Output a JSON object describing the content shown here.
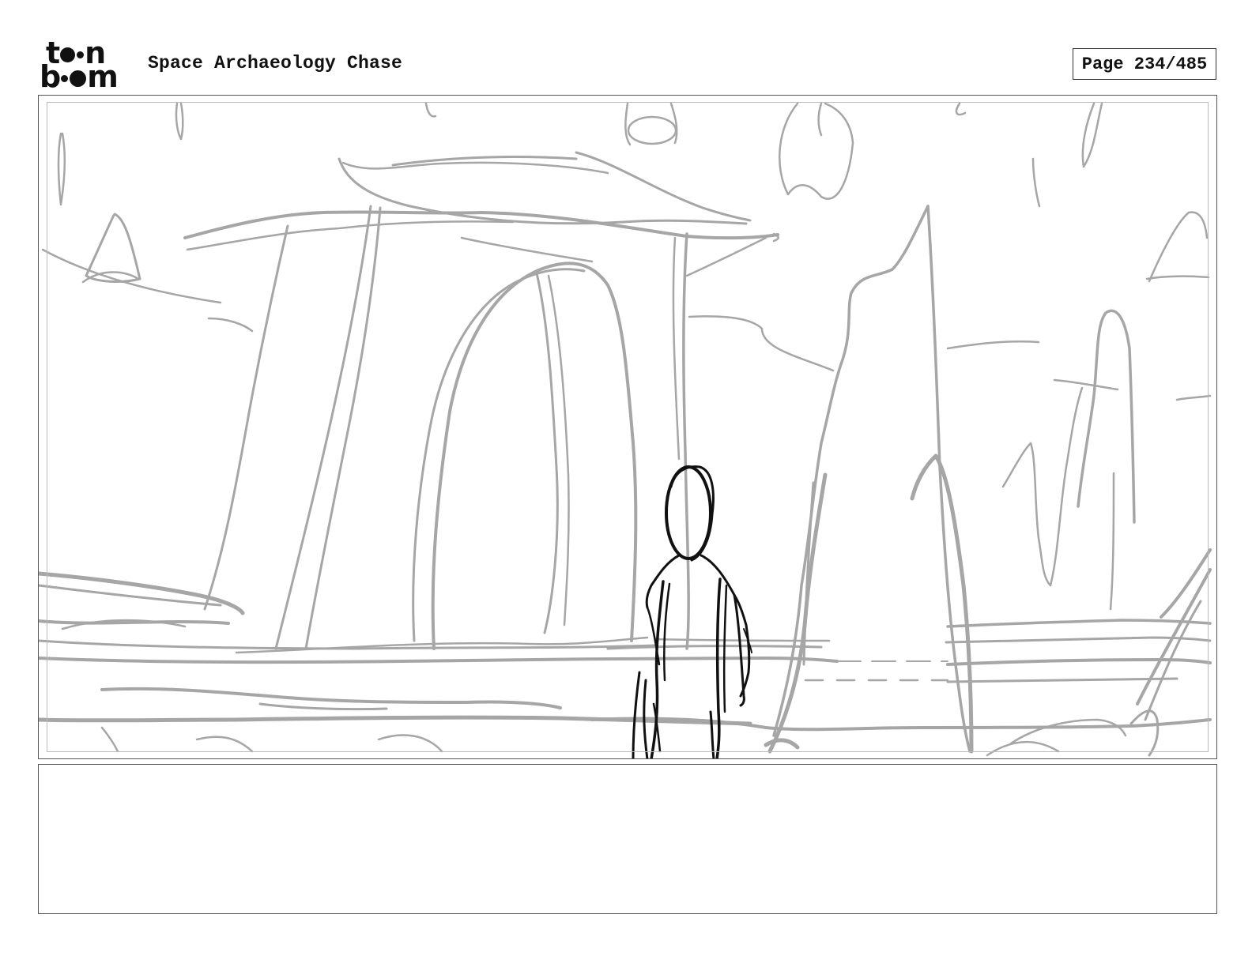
{
  "header": {
    "logo_text": "toon boom",
    "project_title": "Space Archaeology Chase",
    "page_label": "Page 234/485"
  },
  "panel": {
    "sketch": "storyboard-panel"
  },
  "notes": {
    "text": ""
  },
  "colors": {
    "background_sketch": "#a6a6a6",
    "character_sketch": "#111111",
    "border": "#555555"
  }
}
